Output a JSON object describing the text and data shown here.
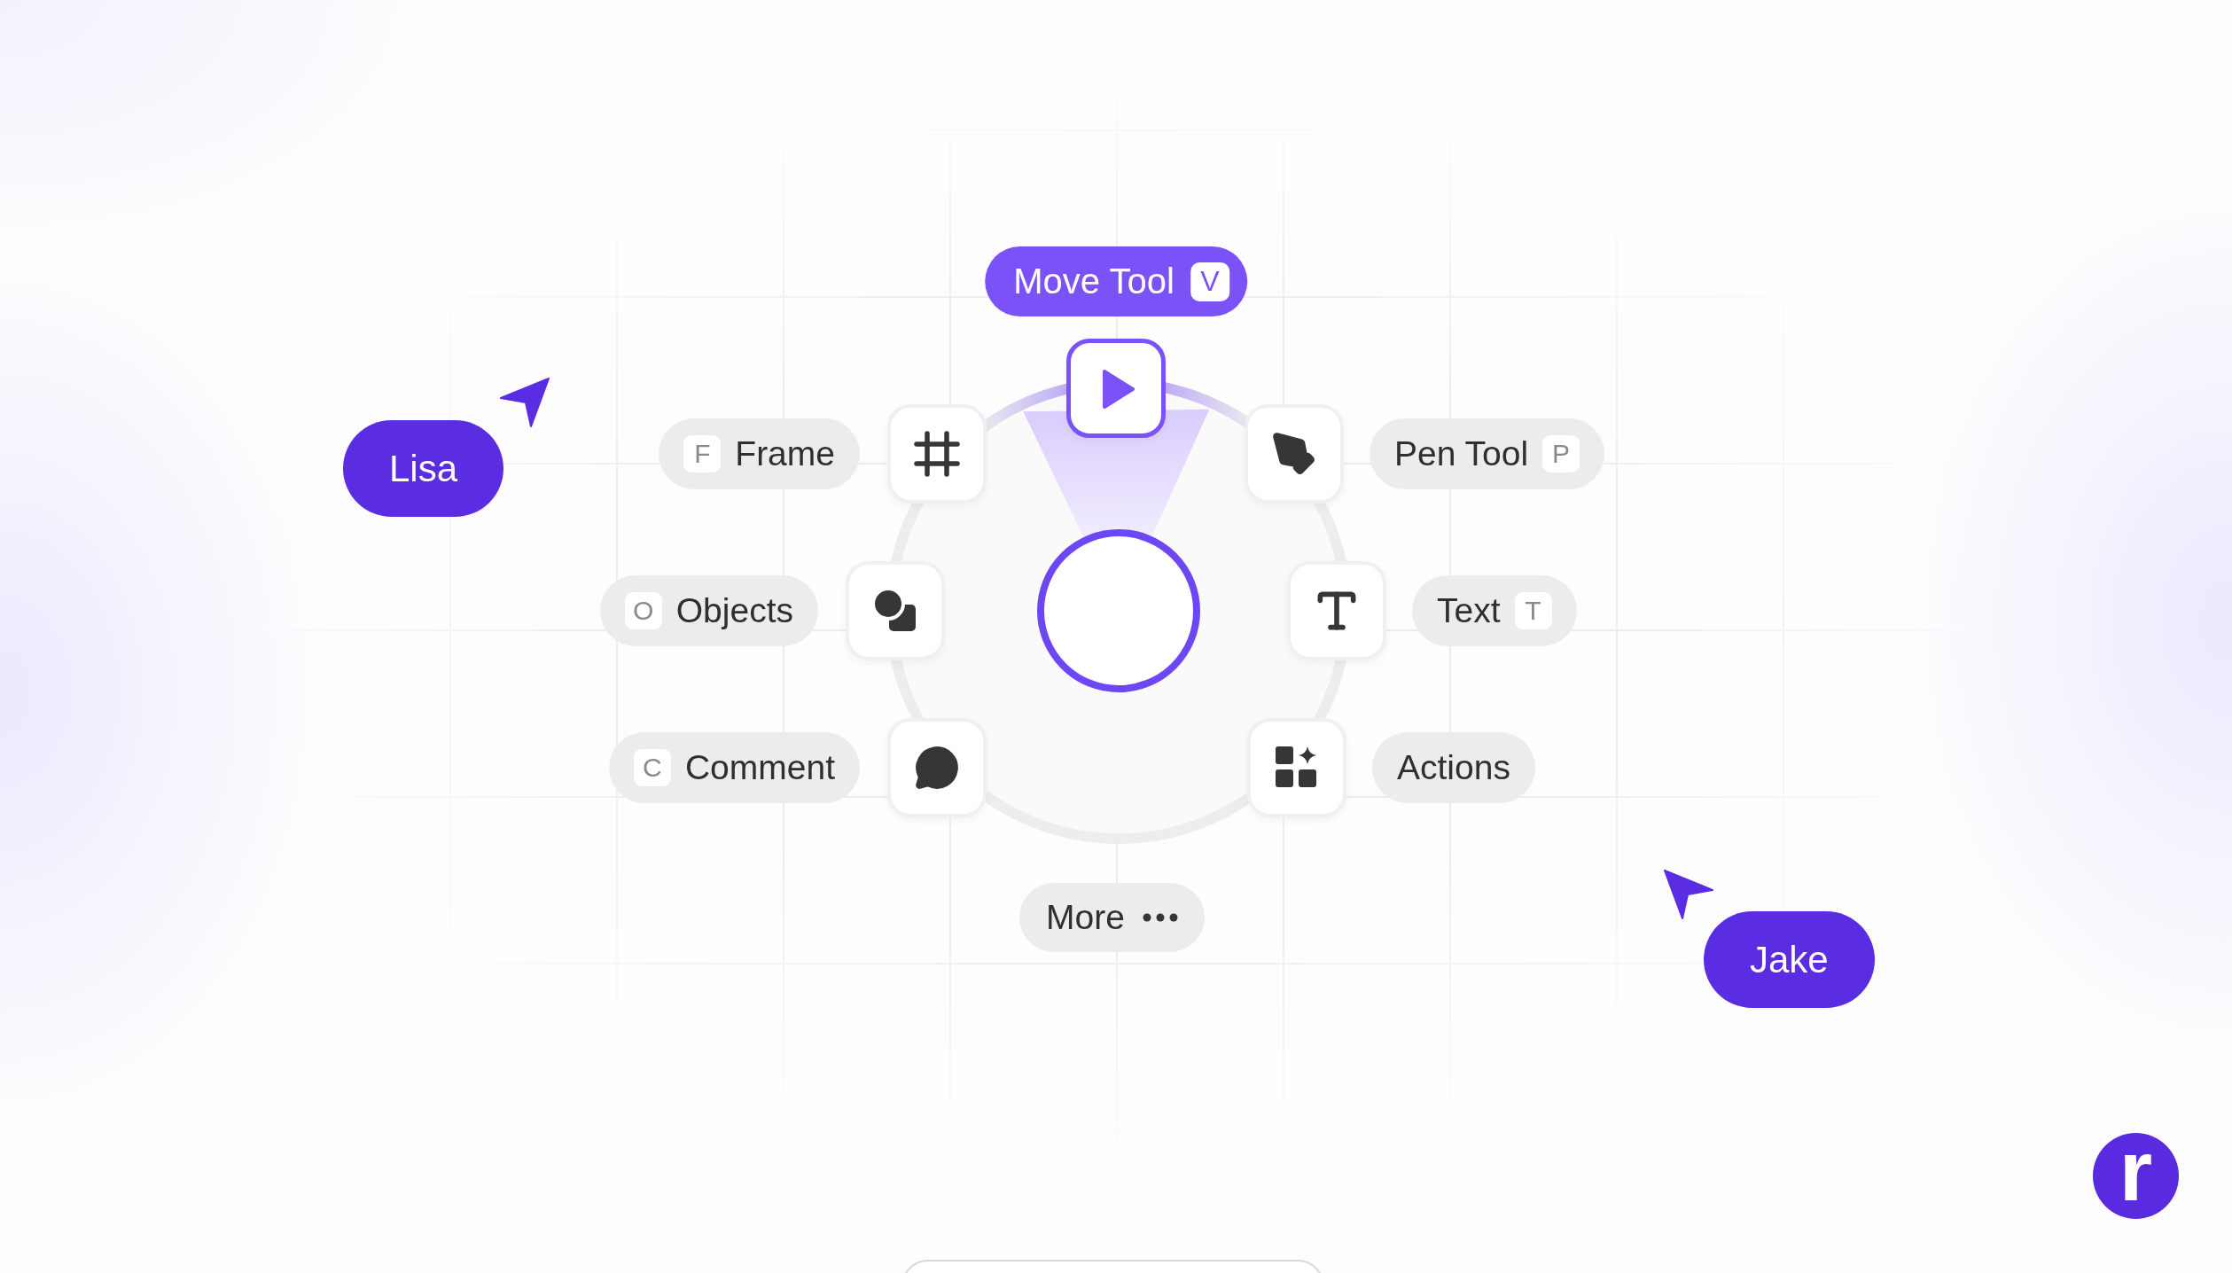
{
  "tooltip": {
    "label": "Move Tool",
    "key": "V"
  },
  "tools": [
    {
      "kind": "pointer",
      "selected": true
    },
    {
      "kind": "frame",
      "selected": false,
      "label": "Frame",
      "key": "F"
    },
    {
      "kind": "pen",
      "selected": false,
      "label": "Pen Tool",
      "key": "P"
    },
    {
      "kind": "shapes",
      "selected": false,
      "label": "Objects",
      "key": "O"
    },
    {
      "kind": "text",
      "selected": false,
      "label": "Text",
      "key": "T"
    },
    {
      "kind": "comment",
      "selected": false,
      "label": "Comment",
      "key": "C"
    },
    {
      "kind": "actions",
      "selected": false,
      "label": "Actions"
    }
  ],
  "more": {
    "label": "More"
  },
  "users": [
    {
      "name": "Lisa"
    },
    {
      "name": "Jake"
    }
  ],
  "logo": {
    "letter": "r"
  }
}
